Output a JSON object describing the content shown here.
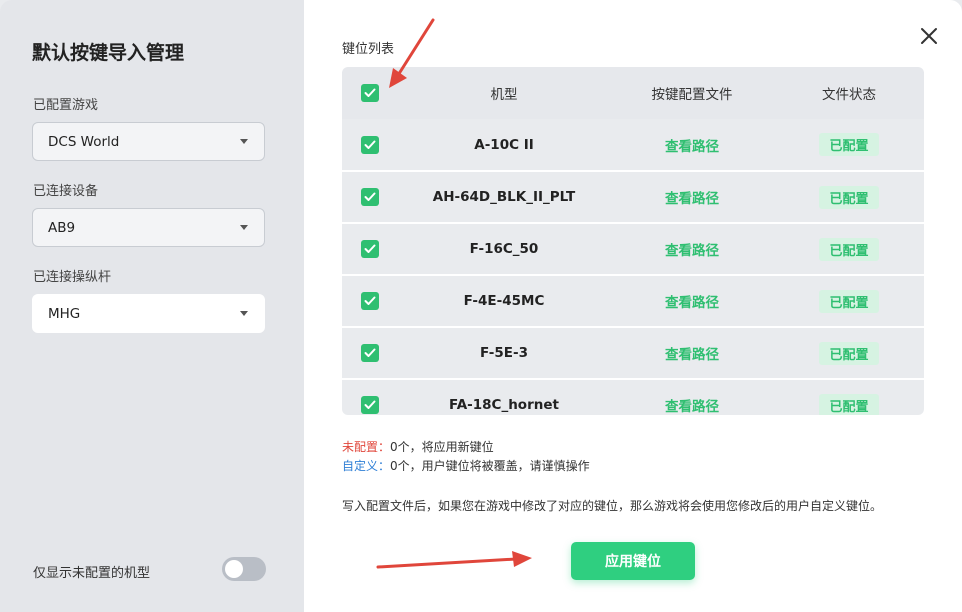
{
  "left": {
    "title": "默认按键导入管理",
    "game_label": "已配置游戏",
    "game_value": "DCS World",
    "device_label": "已连接设备",
    "device_value": "AB9",
    "joystick_label": "已连接操纵杆",
    "joystick_value": "MHG",
    "toggle_label": "仅显示未配置的机型",
    "toggle_on": false
  },
  "right": {
    "section_label": "键位列表",
    "columns": [
      "机型",
      "按键配置文件",
      "文件状态"
    ],
    "rows": [
      {
        "model": "A-10C II",
        "file": "查看路径",
        "state": "已配置"
      },
      {
        "model": "AH-64D_BLK_II_PLT",
        "file": "查看路径",
        "state": "已配置"
      },
      {
        "model": "F-16C_50",
        "file": "查看路径",
        "state": "已配置"
      },
      {
        "model": "F-4E-45MC",
        "file": "查看路径",
        "state": "已配置"
      },
      {
        "model": "F-5E-3",
        "file": "查看路径",
        "state": "已配置"
      },
      {
        "model": "FA-18C_hornet",
        "file": "查看路径",
        "state": "已配置"
      }
    ],
    "notes": {
      "unconfigured_label": "未配置：",
      "unconfigured_text": "0个，将应用新键位",
      "custom_label": "自定义：",
      "custom_text": "0个，用户键位将被覆盖，请谨慎操作"
    },
    "info": "写入配置文件后，如果您在游戏中修改了对应的键位，那么游戏将会使用您修改后的用户自定义键位。",
    "apply_label": "应用键位"
  },
  "colors": {
    "accent": "#2fcf80",
    "link": "#2fbf71",
    "warning": "#e0463b",
    "info": "#2f7fd6",
    "annotation_arrow": "#e0463b"
  }
}
